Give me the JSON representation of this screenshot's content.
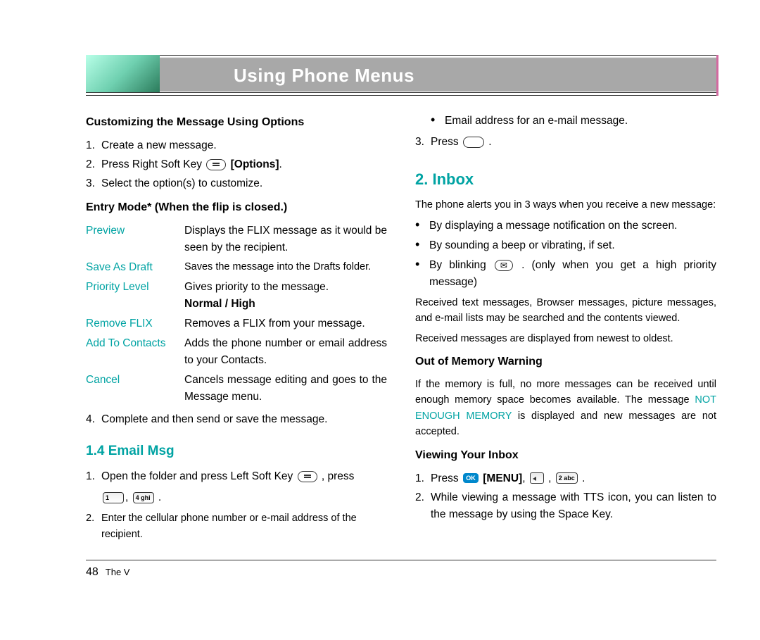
{
  "header": {
    "title": "Using Phone Menus"
  },
  "left": {
    "custom_heading": "Customizing the Message Using Options",
    "steps1": {
      "s1": "Create a new message.",
      "s2a": "Press Right Soft Key ",
      "s2b": "[Options]",
      "s2c": ".",
      "s3": "Select the option(s) to customize."
    },
    "entry_mode": "Entry Mode* (When the flip is closed.)",
    "options": {
      "preview": {
        "name": "Preview",
        "desc": "Displays the FLIX message as it would be seen by the recipient."
      },
      "save": {
        "name": "Save As Draft",
        "desc": "Saves the message into the Drafts folder."
      },
      "priority": {
        "name": "Priority Level",
        "desc": "Gives priority to the message.",
        "extra": "Normal / High"
      },
      "remove": {
        "name": "Remove FLIX",
        "desc": "Removes a FLIX from your message."
      },
      "add": {
        "name": "Add To Contacts",
        "desc": "Adds the phone number or email address to your Contacts."
      },
      "cancel": {
        "name": "Cancel",
        "desc": "Cancels message editing and goes to the Message menu."
      }
    },
    "step4": "Complete and then send or save the message.",
    "email_msg_heading": "1.4 Email Msg",
    "email_step1a": "Open the folder and press  Left Soft Key ",
    "email_step1b": ", press",
    "email_keys_1": "1",
    "email_keys_sep": ", ",
    "email_keys_4": "4 ghi",
    "email_step1_end": " .",
    "email_step2": "Enter the cellular phone number or e-mail address of the recipient."
  },
  "right": {
    "bullet_email": "Email address for an e-mail message.",
    "press_label": "Press ",
    "press_end": " .",
    "inbox_heading": "2. Inbox",
    "inbox_intro": "The phone alerts you in 3 ways when you receive a new message:",
    "alert1": "By displaying a message notification on the screen.",
    "alert2": "By sounding a beep or vibrating, if set.",
    "alert3a": "By blinking ",
    "alert3b": ". (only when you get a high priority message)",
    "received_p1": "Received text messages, Browser messages, picture messages, and e-mail lists may be searched and the contents viewed.",
    "received_p2": "Received messages are displayed from newest to oldest.",
    "oom_heading": "Out of Memory Warning",
    "oom_body_a": "If the memory is full, no more messages can be received until enough memory space becomes available. The message ",
    "oom_body_b": "NOT ENOUGH MEMORY",
    "oom_body_c": " is displayed and new messages are not accepted.",
    "view_heading": "Viewing Your Inbox",
    "view_step1a": "Press  ",
    "view_menu": "[MENU]",
    "view_step1b": ", ",
    "view_key2": "2 abc",
    "view_step1c": " .",
    "view_step2": "While viewing a message with TTS icon, you can listen to the message by using the Space Key."
  },
  "footer": {
    "page_num": "48",
    "title": "The V"
  }
}
